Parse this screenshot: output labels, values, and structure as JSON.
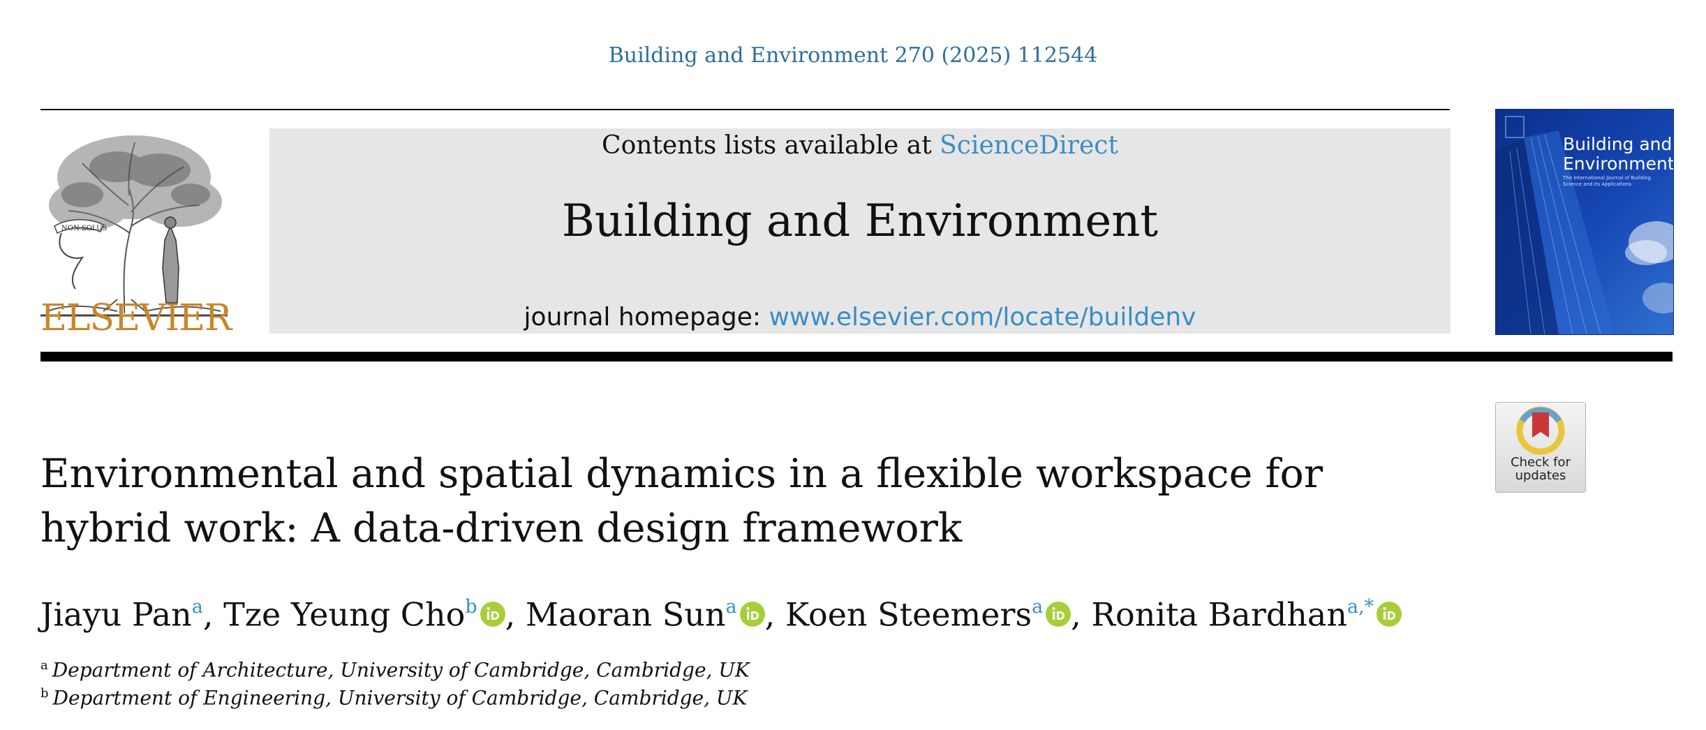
{
  "header": {
    "citation": "Building and Environment 270 (2025) 112544",
    "contents_prefix": "Contents lists available at ",
    "sciencedirect": "ScienceDirect",
    "journal_name": "Building and Environment",
    "homepage_prefix": "journal homepage: ",
    "homepage_url": "www.elsevier.com/locate/buildenv",
    "publisher": "ELSEVIER",
    "logo_motto": "NON SOLUS"
  },
  "cover": {
    "title_line1": "Building and",
    "title_line2": "Environment",
    "subtitle": "The International Journal of Building Science and its Applications"
  },
  "check_updates": {
    "line1": "Check for",
    "line2": "updates"
  },
  "article": {
    "title": "Environmental and spatial dynamics in a flexible workspace for hybrid work: A data-driven design framework",
    "authors": [
      {
        "name": "Jiayu Pan",
        "sup": "a",
        "orcid": false
      },
      {
        "name": "Tze Yeung Cho",
        "sup": "b",
        "orcid": true
      },
      {
        "name": "Maoran Sun",
        "sup": "a",
        "orcid": true
      },
      {
        "name": "Koen Steemers",
        "sup": "a",
        "orcid": true
      },
      {
        "name": "Ronita Bardhan",
        "sup": "a,*",
        "orcid": true
      }
    ],
    "affiliations": [
      {
        "mark": "a",
        "text": "Department of Architecture, University of Cambridge, Cambridge, UK"
      },
      {
        "mark": "b",
        "text": "Department of Engineering, University of Cambridge, Cambridge, UK"
      }
    ]
  },
  "colors": {
    "link_blue": "#3b8dc6",
    "citation_blue": "#2d6e9e",
    "elsevier_orange": "#c8862c",
    "orcid_green": "#a6ce39",
    "banner_gray": "#e6e6e6"
  }
}
